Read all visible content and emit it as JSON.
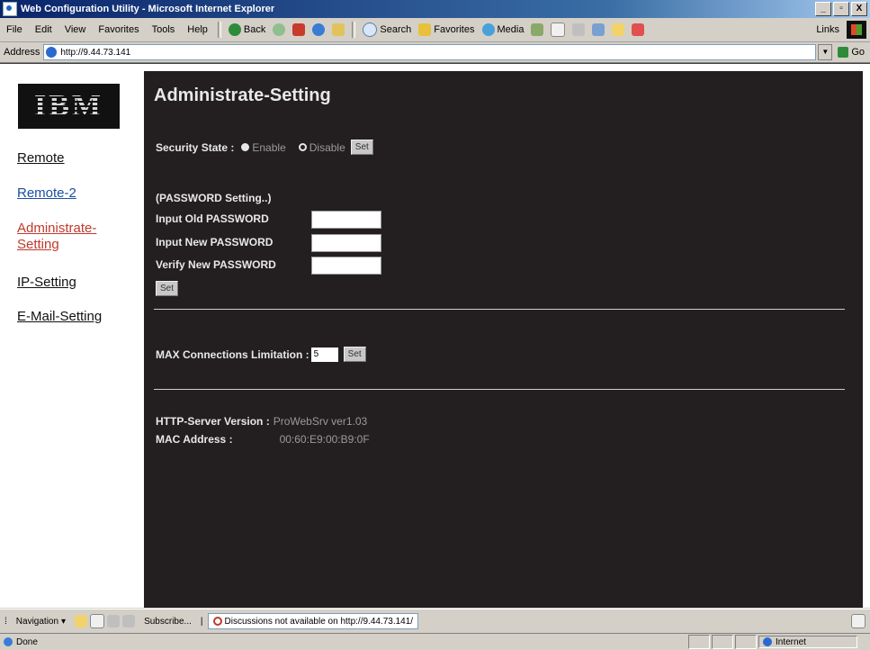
{
  "window": {
    "title": "Web Configuration Utility - Microsoft Internet Explorer",
    "min": "_",
    "max": "▫",
    "close": "X"
  },
  "menu": [
    "File",
    "Edit",
    "View",
    "Favorites",
    "Tools",
    "Help"
  ],
  "toolbar": {
    "back": "Back",
    "search": "Search",
    "favorites": "Favorites",
    "media": "Media",
    "links": "Links"
  },
  "address": {
    "label": "Address",
    "url": "http://9.44.73.141",
    "go": "Go"
  },
  "sidebar": {
    "logo": "IBM",
    "links": [
      {
        "label": "Remote"
      },
      {
        "label": "Remote-2"
      },
      {
        "label_line1": "Administrate-",
        "label_line2": "Setting"
      },
      {
        "label": "IP-Setting"
      },
      {
        "label": "E-Mail-Setting"
      }
    ]
  },
  "main": {
    "title": "Administrate-Setting",
    "security_state_label": "Security State :",
    "enable_label": "Enable",
    "disable_label": "Disable",
    "selected_state": "Disable",
    "set_label": "Set",
    "password_heading": "(PASSWORD Setting..)",
    "old_password_label": "Input Old PASSWORD",
    "new_password_label": "Input New PASSWORD",
    "verify_password_label": "Verify New PASSWORD",
    "max_conn_label": "MAX Connections Limitation :",
    "max_conn_value": "5",
    "http_version_label": "HTTP-Server Version :",
    "http_version_value": "ProWebSrv ver1.03",
    "mac_label": "MAC Address :",
    "mac_value": "00:60:E9:00:B9:0F"
  },
  "bottom_toolbar": {
    "navigation": "Navigation",
    "subscribe": "Subscribe...",
    "message": "Discussions not available on http://9.44.73.141/"
  },
  "status": {
    "text": "Done",
    "zone": "Internet"
  },
  "colors": {
    "panel_bg": "#231f20",
    "active_link": "#c0392b",
    "link_blue": "#1a4fa0"
  }
}
